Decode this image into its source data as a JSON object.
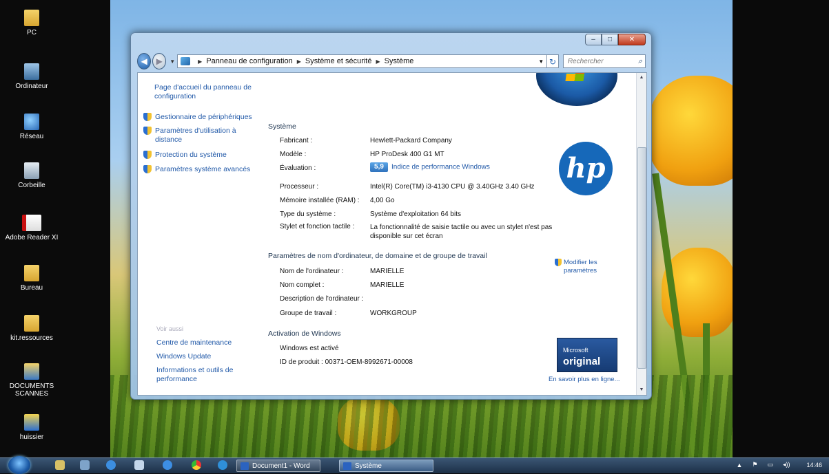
{
  "desktop": {
    "icons": [
      {
        "label": "PC",
        "icon": "folder-icon"
      },
      {
        "label": "Ordinateur",
        "icon": "computer-icon"
      },
      {
        "label": "Réseau",
        "icon": "network-icon"
      },
      {
        "label": "Corbeille",
        "icon": "recycle-bin-icon"
      },
      {
        "label": "Adobe Reader XI",
        "icon": "pdf-icon"
      },
      {
        "label": "Bureau",
        "icon": "folder-icon"
      },
      {
        "label": "kit.ressources",
        "icon": "folder-icon"
      },
      {
        "label": "DOCUMENTS SCANNES",
        "icon": "scan-folder-icon"
      },
      {
        "label": "huissier",
        "icon": "app-icon"
      }
    ]
  },
  "window": {
    "controls": {
      "minimize": "–",
      "maximize": "□",
      "close": "✕"
    },
    "breadcrumb": [
      "Panneau de configuration",
      "Système et sécurité",
      "Système"
    ],
    "search_placeholder": "Rechercher",
    "left_pane": {
      "home": "Page d'accueil du panneau de configuration",
      "tasks": [
        "Gestionnaire de périphériques",
        "Paramètres d'utilisation à distance",
        "Protection du système",
        "Paramètres système avancés"
      ],
      "see_also_title": "Voir aussi",
      "see_also": [
        "Centre de maintenance",
        "Windows Update",
        "Informations et outils de performance"
      ]
    },
    "system": {
      "title": "Système",
      "rows": [
        {
          "label": "Fabricant :",
          "value": "Hewlett-Packard Company"
        },
        {
          "label": "Modèle :",
          "value": "HP ProDesk 400 G1 MT"
        },
        {
          "label": "Évaluation :",
          "value": "Indice de performance Windows",
          "badge": "5,9"
        },
        {
          "label": "Processeur :",
          "value": "Intel(R) Core(TM) i3-4130 CPU @ 3.40GHz 3.40 GHz"
        },
        {
          "label": "Mémoire installée (RAM) :",
          "value": "4,00 Go"
        },
        {
          "label": "Type du système :",
          "value": "Système d'exploitation 64 bits"
        },
        {
          "label": "Stylet et fonction tactile :",
          "value": "La fonctionnalité de saisie tactile ou avec un stylet n'est pas disponible sur cet écran"
        }
      ]
    },
    "computer_name": {
      "title": "Paramètres de nom d'ordinateur, de domaine et de groupe de travail",
      "change_link": "Modifier les paramètres",
      "rows": [
        {
          "label": "Nom de l'ordinateur :",
          "value": "MARIELLE"
        },
        {
          "label": "Nom complet :",
          "value": "MARIELLE"
        },
        {
          "label": "Description de l'ordinateur :",
          "value": ""
        },
        {
          "label": "Groupe de travail :",
          "value": "WORKGROUP"
        }
      ]
    },
    "activation": {
      "title": "Activation de Windows",
      "status": "Windows est activé",
      "product_id": "ID de produit : 00371-OEM-8992671-00008",
      "genuine_line1": "Microsoft",
      "genuine_line2": "original",
      "more_link": "En savoir plus en ligne..."
    },
    "hp_logo_text": "hp"
  },
  "taskbar": {
    "tasks": [
      "Document1 - Word",
      "Système"
    ],
    "clock": "14:46",
    "tray": [
      "▲",
      "⚑",
      "▭",
      "◂))"
    ]
  }
}
